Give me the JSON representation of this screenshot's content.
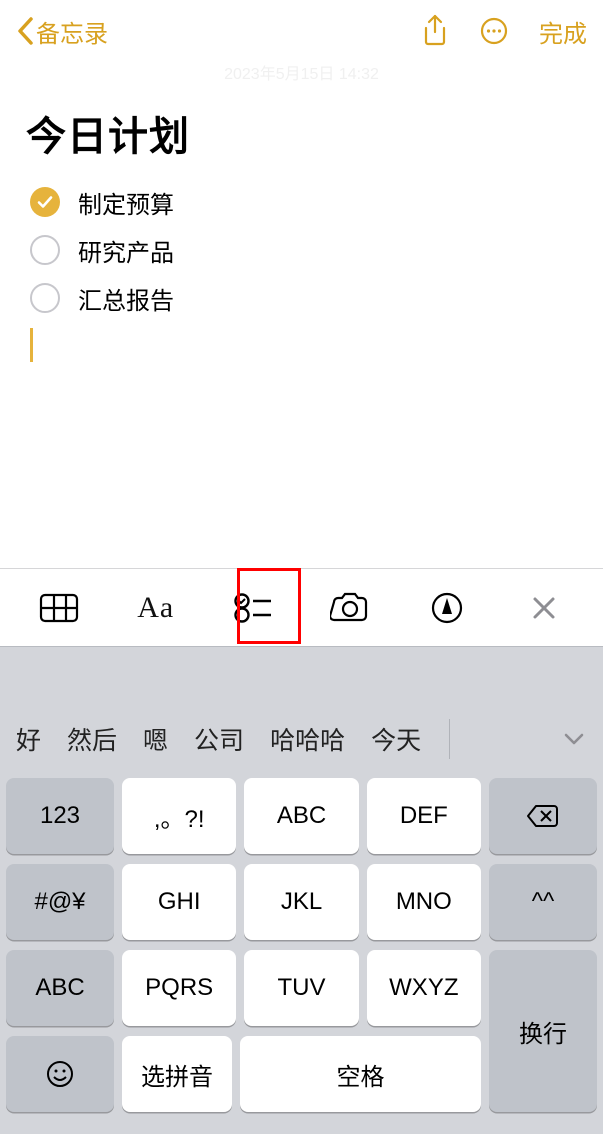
{
  "nav": {
    "back_label": "备忘录",
    "done_label": "完成"
  },
  "timestamp": "2023年5月15日 14:32",
  "note": {
    "title": "今日计划",
    "items": [
      {
        "text": "制定预算",
        "checked": true
      },
      {
        "text": "研究产品",
        "checked": false
      },
      {
        "text": "汇总报告",
        "checked": false
      }
    ]
  },
  "format_bar": {
    "aa": "Aa",
    "highlighted_index": 2
  },
  "candidates": [
    "好",
    "然后",
    "嗯",
    "公司",
    "哈哈哈",
    "今天"
  ],
  "keyboard": {
    "r1": {
      "k0": "123",
      "k1": ",。?!",
      "k2": "ABC",
      "k3": "DEF"
    },
    "r2": {
      "k0": "#@¥",
      "k1": "GHI",
      "k2": "JKL",
      "k3": "MNO",
      "k4": "^^"
    },
    "r3": {
      "k0": "ABC",
      "k1": "PQRS",
      "k2": "TUV",
      "k3": "WXYZ"
    },
    "r4": {
      "k1": "选拼音",
      "k2": "空格",
      "return": "换行"
    }
  }
}
